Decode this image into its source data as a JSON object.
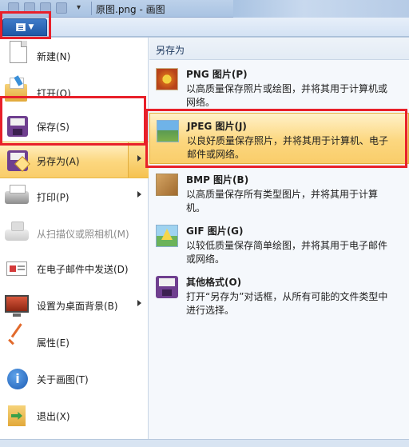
{
  "window": {
    "title": "原图.png - 画图"
  },
  "menu": {
    "items": [
      {
        "label": "新建(N)"
      },
      {
        "label": "打开(O)"
      },
      {
        "label": "保存(S)"
      },
      {
        "label": "另存为(A)"
      },
      {
        "label": "打印(P)"
      },
      {
        "label": "从扫描仪或照相机(M)"
      },
      {
        "label": "在电子邮件中发送(D)"
      },
      {
        "label": "设置为桌面背景(B)"
      },
      {
        "label": "属性(E)"
      },
      {
        "label": "关于画图(T)"
      },
      {
        "label": "退出(X)"
      }
    ]
  },
  "save_as": {
    "header": "另存为",
    "options": [
      {
        "title": "PNG 图片(P)",
        "desc": "以高质量保存照片或绘图，并将其用于计算机或网络。"
      },
      {
        "title": "JPEG 图片(J)",
        "desc": "以良好质量保存照片，并将其用于计算机、电子邮件或网络。"
      },
      {
        "title": "BMP 图片(B)",
        "desc": "以高质量保存所有类型图片，并将其用于计算机。"
      },
      {
        "title": "GIF 图片(G)",
        "desc": "以较低质量保存简单绘图，并将其用于电子邮件或网络。"
      },
      {
        "title": "其他格式(O)",
        "desc": "打开“另存为”对话框，从所有可能的文件类型中进行选择。"
      }
    ]
  },
  "colors": {
    "highlight_border": "#e8202a",
    "active_fill": "#fcd77f",
    "app_button": "#1f58a6"
  }
}
